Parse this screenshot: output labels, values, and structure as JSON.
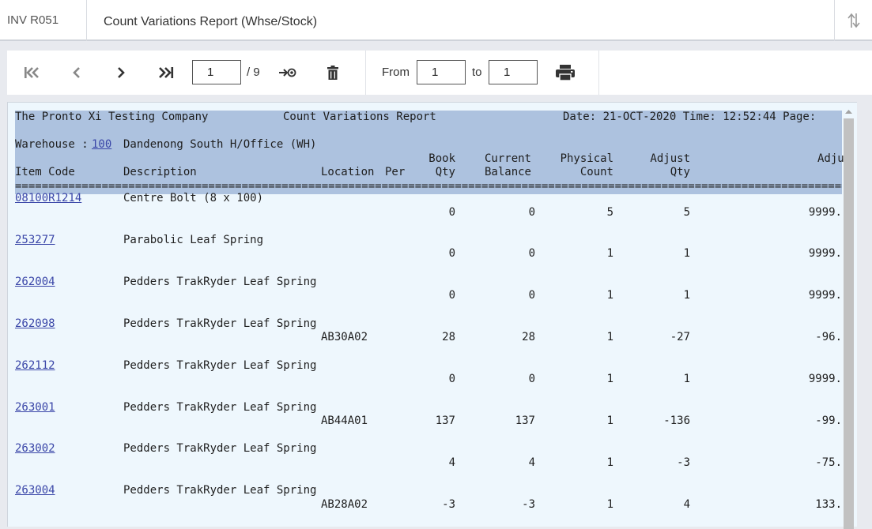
{
  "window": {
    "report_code": "INV R051",
    "title": "Count Variations Report (Whse/Stock)"
  },
  "toolbar": {
    "page_value": "1",
    "page_total": "/ 9",
    "from_label": "From",
    "from_value": "1",
    "to_label": "to",
    "to_value": "1",
    "icons": [
      "first-page-icon",
      "previous-page-icon",
      "next-page-icon",
      "last-page-icon",
      "go-to-page-icon",
      "delete-icon",
      "print-icon"
    ]
  },
  "report": {
    "company": "The Pronto Xi Testing Company",
    "report_name": "Count Variations Report",
    "date_time": "Date: 21-OCT-2020 Time: 12:52:44 Page:",
    "warehouse_label": "Warehouse :",
    "warehouse_code": "100",
    "warehouse_name": "Dandenong South H/Office (WH)",
    "columns": {
      "item_code": "Item Code",
      "description": "Description",
      "location": "Location",
      "per": "Per",
      "book_qty_1": "Book",
      "book_qty_2": "Qty",
      "current_balance_1": "Current",
      "current_balance_2": "Balance",
      "physical_count_1": "Physical",
      "physical_count_2": "Count",
      "adjust_qty_1": "Adjust",
      "adjust_qty_2": "Qty",
      "adj_value": "Adju"
    },
    "rule": "==========================================================================================================================================",
    "rows": [
      {
        "item": "08100R1214",
        "desc": "Centre Bolt (8 x 100)",
        "loc": "",
        "book": "0",
        "balance": "0",
        "count": "5",
        "adjust": "5",
        "adj": "9999."
      },
      {
        "item": "253277",
        "desc": "Parabolic Leaf Spring",
        "loc": "",
        "book": "0",
        "balance": "0",
        "count": "1",
        "adjust": "1",
        "adj": "9999."
      },
      {
        "item": "262004",
        "desc": "Pedders TrakRyder Leaf Spring",
        "loc": "",
        "book": "0",
        "balance": "0",
        "count": "1",
        "adjust": "1",
        "adj": "9999."
      },
      {
        "item": "262098",
        "desc": "Pedders TrakRyder Leaf Spring",
        "loc": "AB30A02",
        "book": "28",
        "balance": "28",
        "count": "1",
        "adjust": "-27",
        "adj": "-96."
      },
      {
        "item": "262112",
        "desc": "Pedders TrakRyder Leaf Spring",
        "loc": "",
        "book": "0",
        "balance": "0",
        "count": "1",
        "adjust": "1",
        "adj": "9999."
      },
      {
        "item": "263001",
        "desc": "Pedders TrakRyder Leaf Spring",
        "loc": "AB44A01",
        "book": "137",
        "balance": "137",
        "count": "1",
        "adjust": "-136",
        "adj": "-99."
      },
      {
        "item": "263002",
        "desc": "Pedders TrakRyder Leaf Spring",
        "loc": "",
        "book": "4",
        "balance": "4",
        "count": "1",
        "adjust": "-3",
        "adj": "-75."
      },
      {
        "item": "263004",
        "desc": "Pedders TrakRyder Leaf Spring",
        "loc": "AB28A02",
        "book": "-3",
        "balance": "-3",
        "count": "1",
        "adjust": "4",
        "adj": "133."
      }
    ]
  },
  "colors": {
    "header_band": "#adc2df",
    "report_bg": "#eef7fd",
    "link": "#3a46a8"
  }
}
